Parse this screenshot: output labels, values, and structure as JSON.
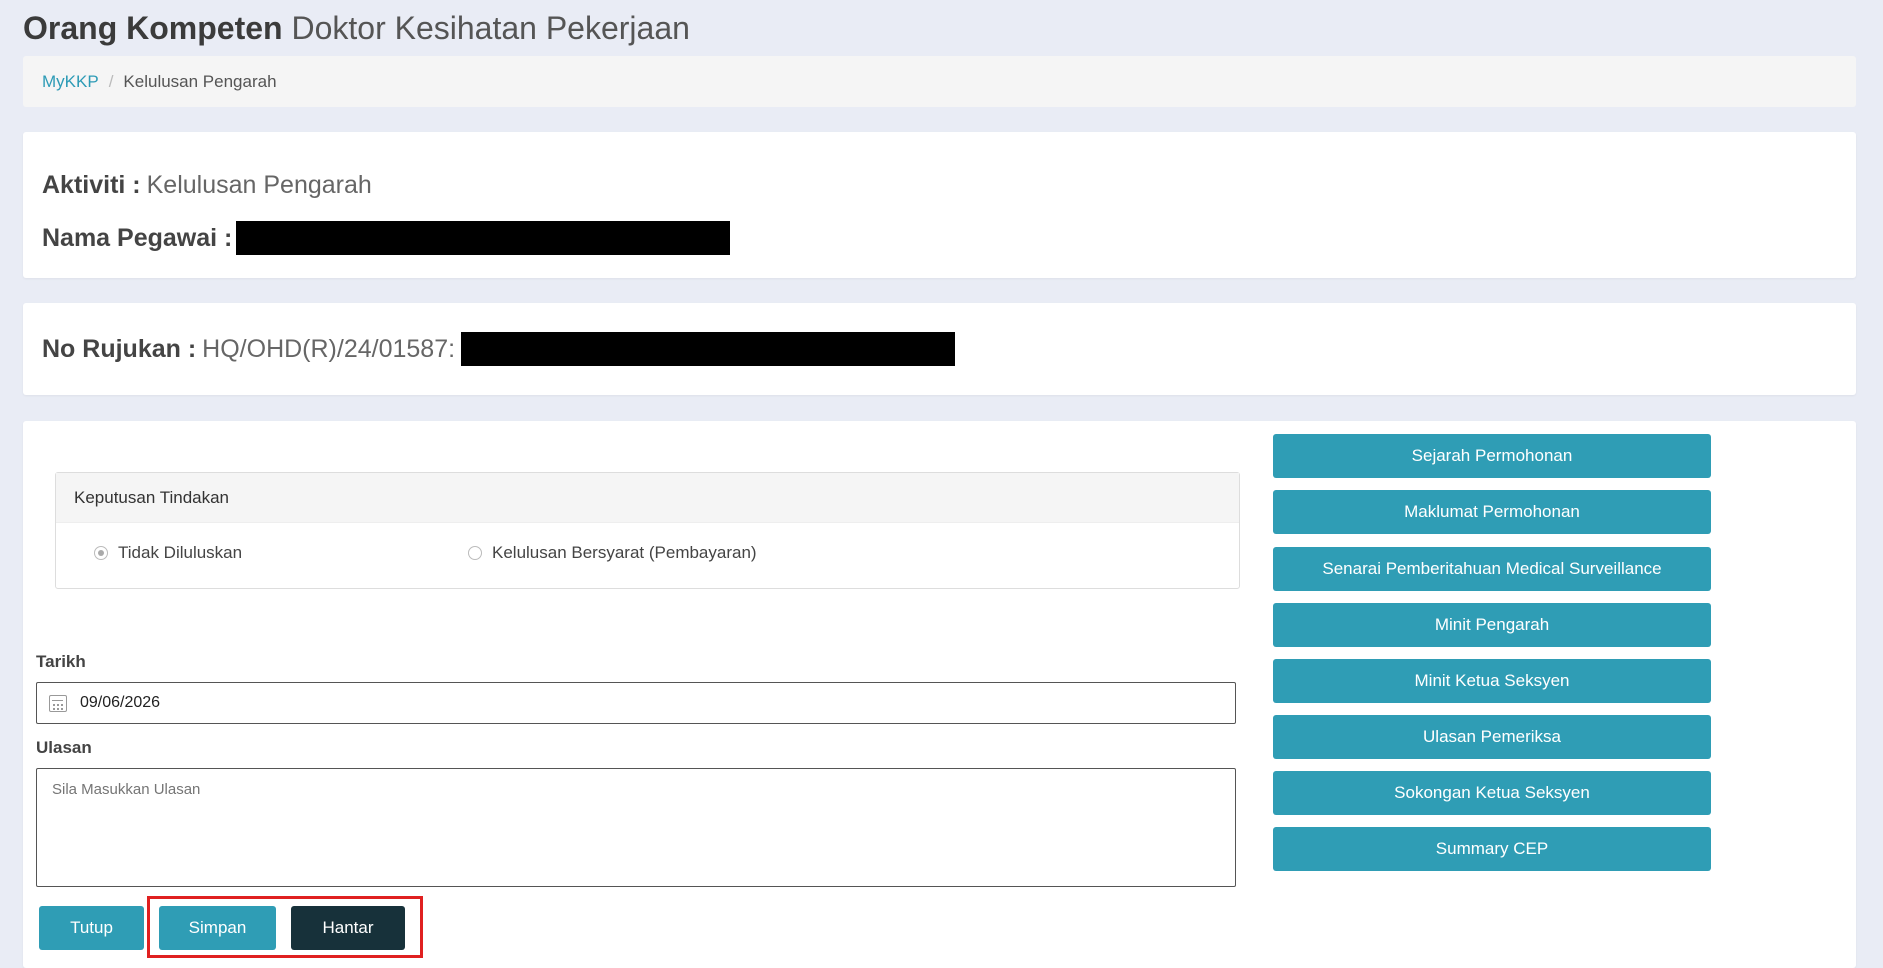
{
  "page": {
    "title_bold": "Orang Kompeten",
    "title_light": "Doktor Kesihatan Pekerjaan"
  },
  "breadcrumb": {
    "root": "MyKKP",
    "separator": "/",
    "current": "Kelulusan Pengarah"
  },
  "info": {
    "aktiviti_label": "Aktiviti :",
    "aktiviti_value": "Kelulusan Pengarah",
    "pegawai_label": "Nama Pegawai :",
    "rujukan_label": "No Rujukan :",
    "rujukan_value": "HQ/OHD(R)/24/01587:"
  },
  "keputusan": {
    "title": "Keputusan Tindakan",
    "options": [
      {
        "label": "Tidak Diluluskan",
        "checked": true
      },
      {
        "label": "Kelulusan Bersyarat (Pembayaran)",
        "checked": false
      }
    ]
  },
  "form": {
    "tarikh_label": "Tarikh",
    "tarikh_value": "09/06/2026",
    "ulasan_label": "Ulasan",
    "ulasan_placeholder": "Sila Masukkan Ulasan"
  },
  "side_buttons": [
    "Sejarah Permohonan",
    "Maklumat Permohonan",
    "Senarai Pemberitahuan Medical Surveillance",
    "Minit Pengarah",
    "Minit Ketua Seksyen",
    "Ulasan Pemeriksa",
    "Sokongan Ketua Seksyen",
    "Summary CEP"
  ],
  "footer": {
    "tutup": "Tutup",
    "simpan": "Simpan",
    "hantar": "Hantar"
  },
  "colors": {
    "accent": "#2f9db5",
    "dark_button": "#17313a",
    "highlight": "#e02020",
    "background": "#e9ecf5"
  },
  "icons": {
    "date_field": "calendar-icon"
  }
}
